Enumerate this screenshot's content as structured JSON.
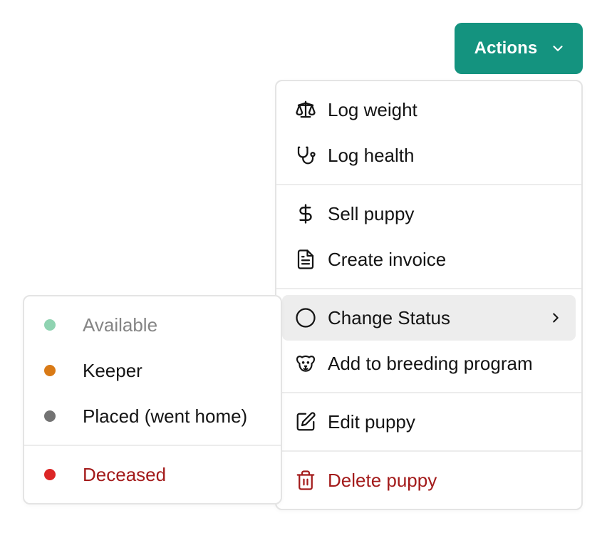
{
  "actions_button": {
    "label": "Actions",
    "color": "#14937f",
    "icon": "chevron-down-icon"
  },
  "main_menu": {
    "groups": [
      [
        {
          "label": "Log weight",
          "icon": "scale-icon"
        },
        {
          "label": "Log health",
          "icon": "stethoscope-icon"
        }
      ],
      [
        {
          "label": "Sell puppy",
          "icon": "dollar-icon"
        },
        {
          "label": "Create invoice",
          "icon": "file-text-icon"
        }
      ],
      [
        {
          "label": "Change Status",
          "icon": "circle-icon",
          "submenu_icon": "chevron-right-icon",
          "highlighted": true
        },
        {
          "label": "Add to breeding program",
          "icon": "dog-icon"
        }
      ],
      [
        {
          "label": "Edit puppy",
          "icon": "edit-icon"
        }
      ],
      [
        {
          "label": "Delete puppy",
          "icon": "trash-icon",
          "danger": true
        }
      ]
    ]
  },
  "status_submenu": {
    "items": [
      {
        "label": "Available",
        "dot_color": "#8fd3b1",
        "disabled": true
      },
      {
        "label": "Keeper",
        "dot_color": "#d97a16"
      },
      {
        "label": "Placed (went home)",
        "dot_color": "#737373"
      },
      {
        "label": "Deceased",
        "dot_color": "#dc2626",
        "danger": true
      }
    ]
  },
  "colors": {
    "accent": "#14937f",
    "danger_text": "#a31b1b",
    "highlight_bg": "#ededed"
  }
}
